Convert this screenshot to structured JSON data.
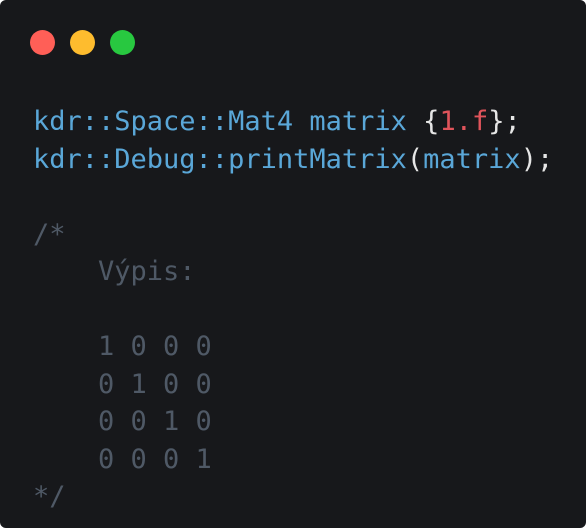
{
  "window": {
    "traffic_lights": {
      "close_color": "#ff5f57",
      "minimize_color": "#febc2e",
      "zoom_color": "#28c840"
    }
  },
  "colors": {
    "background": "#17181b",
    "identifier": "#5aa7d8",
    "number": "#e0545b",
    "punctuation": "#e6e6e6",
    "comment": "#4f5966"
  },
  "code": {
    "line1": {
      "type_name": "kdr::Space::Mat4",
      "var_name": "matrix",
      "brace_open": "{",
      "literal": "1.f",
      "brace_close_semi": "};"
    },
    "line2": {
      "function": "kdr::Debug::printMatrix",
      "paren_open": "(",
      "argument": "matrix",
      "paren_close_semi": ");"
    },
    "comment": {
      "open": "/*",
      "heading": "    Výpis:",
      "rows": [
        "    1 0 0 0",
        "    0 1 0 0",
        "    0 0 1 0",
        "    0 0 0 1"
      ],
      "close": "*/"
    }
  }
}
